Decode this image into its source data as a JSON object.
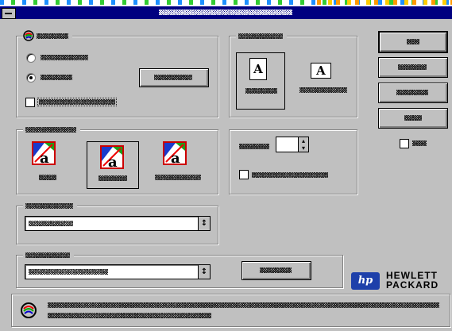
{
  "window": {
    "title": "",
    "system_menu_icon": "system-menu-icon"
  },
  "colors": {
    "face": "#c0c0c0",
    "titlebar": "#000080",
    "hp_blue": "#1e40aa"
  },
  "group_print_quality": {
    "label": "",
    "icon": "rainbow-c-icon",
    "options": [
      "",
      ""
    ],
    "selected_index": 1,
    "button_label": "",
    "checkbox_label": "",
    "checkbox_checked": false
  },
  "group_orientation": {
    "label": "",
    "portrait_label": "",
    "landscape_label": "",
    "selected": "portrait"
  },
  "group_media": {
    "label": "",
    "items": [
      {
        "label": "",
        "icon": "font-color-a-icon"
      },
      {
        "label": "",
        "icon": "font-color-a-icon"
      },
      {
        "label": "",
        "icon": "font-color-a-icon"
      }
    ],
    "selected_index": 1
  },
  "group_copies": {
    "label": "",
    "value": "",
    "checkbox_label": "",
    "checkbox_checked": false
  },
  "dropdown_1": {
    "label": "",
    "value": ""
  },
  "dropdown_2": {
    "label": "",
    "value": "",
    "button_label": ""
  },
  "side_buttons": [
    {
      "label": ""
    },
    {
      "label": ""
    },
    {
      "label": ""
    },
    {
      "label": ""
    }
  ],
  "side_checkbox": {
    "label": "",
    "checked": false
  },
  "brand": {
    "logo": "hp",
    "line1": "HEWLETT",
    "line2": "PACKARD"
  },
  "status": {
    "icon": "rainbow-c-icon",
    "line1": "",
    "line2": ""
  }
}
